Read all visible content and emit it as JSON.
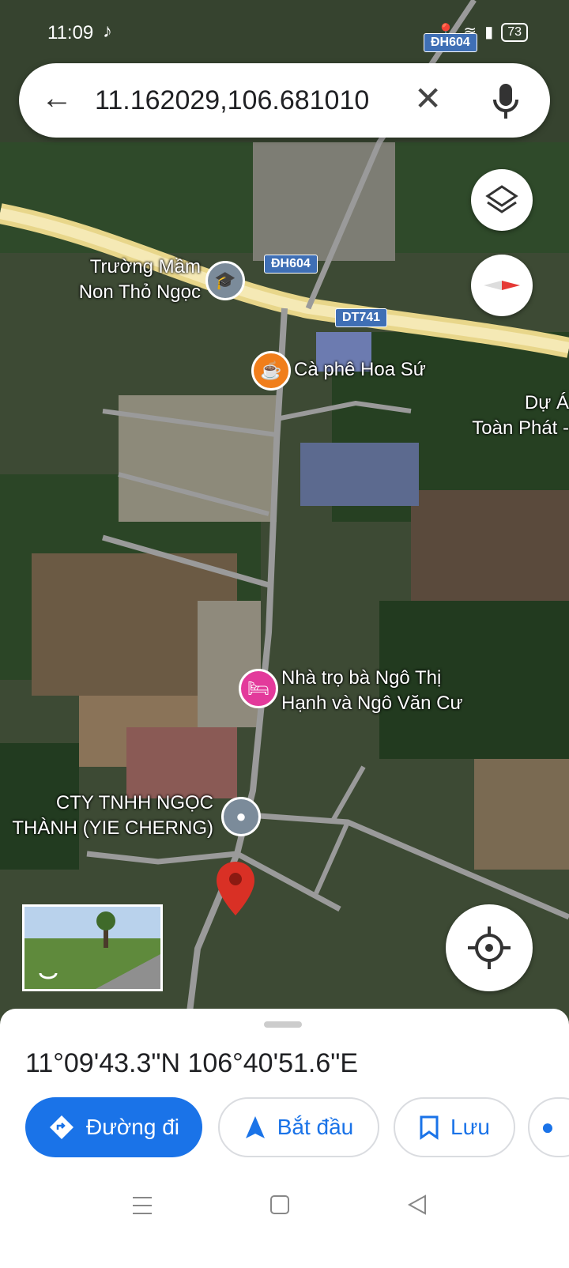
{
  "status": {
    "time": "11:09",
    "battery": "73",
    "network_road": "ĐH604"
  },
  "search": {
    "query": "11.162029,106.681010"
  },
  "map": {
    "places": [
      {
        "name": "Trường Mầm\nNon Thỏ Ngọc",
        "icon": "school-icon"
      },
      {
        "name": "Cà phê Hoa Sứ",
        "icon": "coffee-icon"
      },
      {
        "name": "Dự Á\nToàn Phát -",
        "icon": ""
      },
      {
        "name": "Nhà trọ bà Ngô Thị\nHạnh và Ngô Văn Cư",
        "icon": "bed-icon"
      },
      {
        "name": "CTY TNHH NGỌC\nTHÀNH (YIE CHERNG)",
        "icon": "place-icon"
      }
    ],
    "roads": [
      "ĐH604",
      "DT741"
    ]
  },
  "sheet": {
    "coordinates": "11°09'43.3\"N 106°40'51.6\"E",
    "buttons": {
      "directions": "Đường đi",
      "start": "Bắt đầu",
      "save": "Lưu"
    }
  },
  "colors": {
    "accent": "#1a73e8",
    "pin": "#d93025",
    "school": "#7b8b9a",
    "coffee": "#f07e1b",
    "hotel": "#e33a9b"
  }
}
